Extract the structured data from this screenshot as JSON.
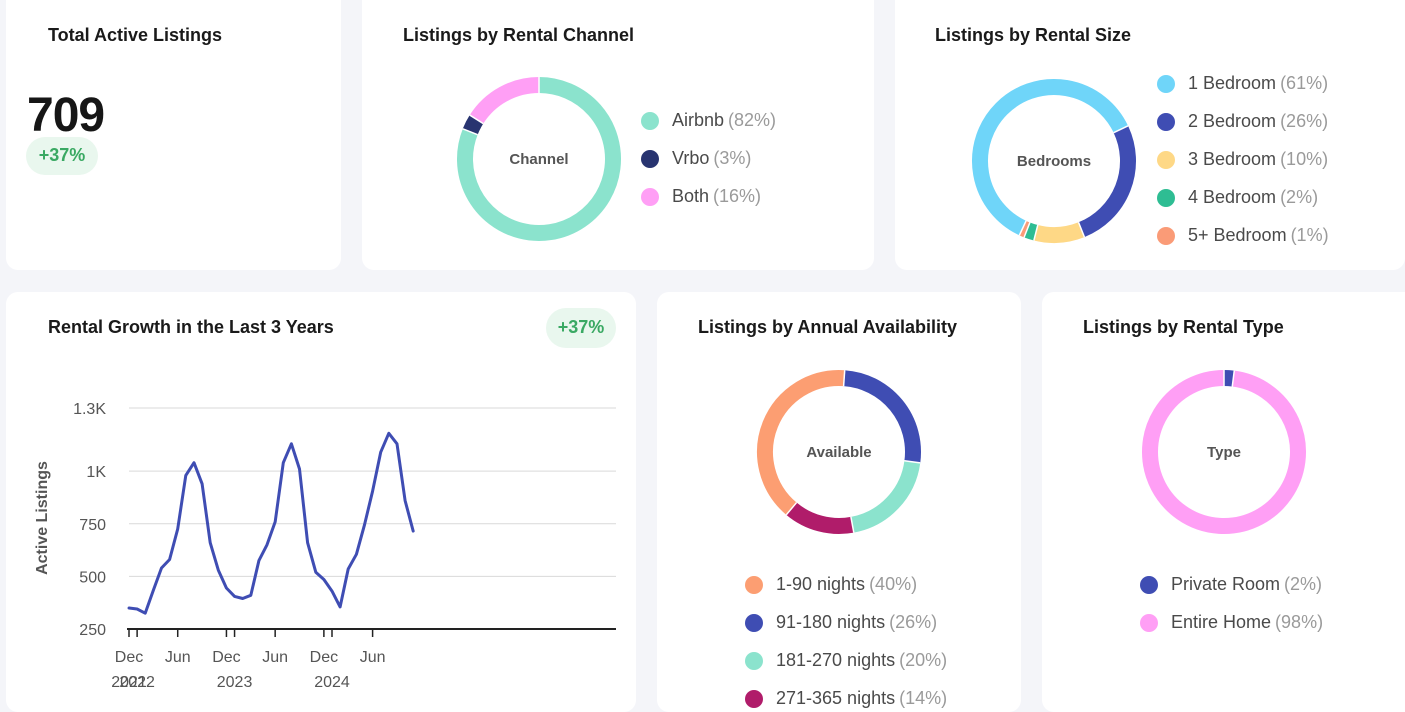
{
  "total_active": {
    "title": "Total Active Listings",
    "value": "709",
    "change": "+37%"
  },
  "rental_channel": {
    "title": "Listings by Rental Channel",
    "center_label": "Channel",
    "items": [
      {
        "name": "Airbnb",
        "pct_label": "(82%)",
        "pct": 81,
        "color": "#8be3cd"
      },
      {
        "name": "Vrbo",
        "pct_label": "(3%)",
        "pct": 3,
        "color": "#283470"
      },
      {
        "name": "Both",
        "pct_label": "(16%)",
        "pct": 16,
        "color": "#ff9ff5"
      }
    ]
  },
  "rental_size": {
    "title": "Listings by Rental Size",
    "center_label": "Bedrooms",
    "items": [
      {
        "name": "1 Bedroom",
        "pct_label": "(61%)",
        "pct": 61,
        "color": "#6fd5f9"
      },
      {
        "name": "2 Bedroom",
        "pct_label": "(26%)",
        "pct": 26,
        "color": "#3f4db3"
      },
      {
        "name": "3 Bedroom",
        "pct_label": "(10%)",
        "pct": 10,
        "color": "#fed886"
      },
      {
        "name": "4 Bedroom",
        "pct_label": "(2%)",
        "pct": 2,
        "color": "#2ebd93"
      },
      {
        "name": "5+ Bedroom",
        "pct_label": "(1%)",
        "pct": 1,
        "color": "#fa9b77"
      }
    ]
  },
  "rental_growth": {
    "title": "Rental Growth in the Last 3 Years",
    "change": "+37%"
  },
  "chart_data": {
    "type": "line",
    "ylabel": "Active Listings",
    "xlabel": "",
    "ylim": [
      250,
      1300
    ],
    "grid": true,
    "y_ticks": [
      {
        "value": 250,
        "label": "250"
      },
      {
        "value": 500,
        "label": "500"
      },
      {
        "value": 750,
        "label": "750"
      },
      {
        "value": 1000,
        "label": "1K"
      },
      {
        "value": 1300,
        "label": "1.3K"
      }
    ],
    "x_ticks": [
      {
        "index": 0,
        "month": "Dec",
        "year": "2021"
      },
      {
        "index": 1,
        "month": "",
        "year": "2022"
      },
      {
        "index": 6,
        "month": "Jun",
        "year": ""
      },
      {
        "index": 12,
        "month": "Dec",
        "year": ""
      },
      {
        "index": 13,
        "month": "",
        "year": "2023"
      },
      {
        "index": 18,
        "month": "Jun",
        "year": ""
      },
      {
        "index": 24,
        "month": "Dec",
        "year": ""
      },
      {
        "index": 25,
        "month": "",
        "year": "2024"
      },
      {
        "index": 30,
        "month": "Jun",
        "year": ""
      }
    ],
    "series": [
      {
        "color": "#3f4db3",
        "x": [
          "2021-12",
          "2022-01",
          "2022-02",
          "2022-03",
          "2022-04",
          "2022-05",
          "2022-06",
          "2022-07",
          "2022-08",
          "2022-09",
          "2022-10",
          "2022-11",
          "2022-12",
          "2023-01",
          "2023-02",
          "2023-03",
          "2023-04",
          "2023-05",
          "2023-06",
          "2023-07",
          "2023-08",
          "2023-09",
          "2023-10",
          "2023-11",
          "2023-12",
          "2024-01",
          "2024-02",
          "2024-03",
          "2024-04",
          "2024-05",
          "2024-06",
          "2024-07",
          "2024-08",
          "2024-09",
          "2024-10",
          "2024-11"
        ],
        "values": [
          350,
          345,
          325,
          435,
          540,
          580,
          725,
          980,
          1040,
          940,
          660,
          530,
          445,
          405,
          395,
          410,
          575,
          650,
          760,
          1040,
          1130,
          1010,
          660,
          520,
          485,
          430,
          355,
          535,
          605,
          745,
          905,
          1090,
          1180,
          1130,
          860,
          715
        ]
      }
    ]
  },
  "annual_availability": {
    "title": "Listings by Annual Availability",
    "center_label": "Available",
    "items": [
      {
        "name": "1-90 nights",
        "pct_label": "(40%)",
        "pct": 40,
        "color": "#fc9e72"
      },
      {
        "name": "91-180 nights",
        "pct_label": "(26%)",
        "pct": 26,
        "color": "#3f4db3"
      },
      {
        "name": "181-270 nights",
        "pct_label": "(20%)",
        "pct": 20,
        "color": "#8be3cd"
      },
      {
        "name": "271-365 nights",
        "pct_label": "(14%)",
        "pct": 14,
        "color": "#b01c6a"
      }
    ]
  },
  "rental_type": {
    "title": "Listings by Rental Type",
    "center_label": "Type",
    "items": [
      {
        "name": "Private Room",
        "pct_label": "(2%)",
        "pct": 2,
        "color": "#3f4db3"
      },
      {
        "name": "Entire Home",
        "pct_label": "(98%)",
        "pct": 98,
        "color": "#ff9ff5"
      }
    ]
  }
}
